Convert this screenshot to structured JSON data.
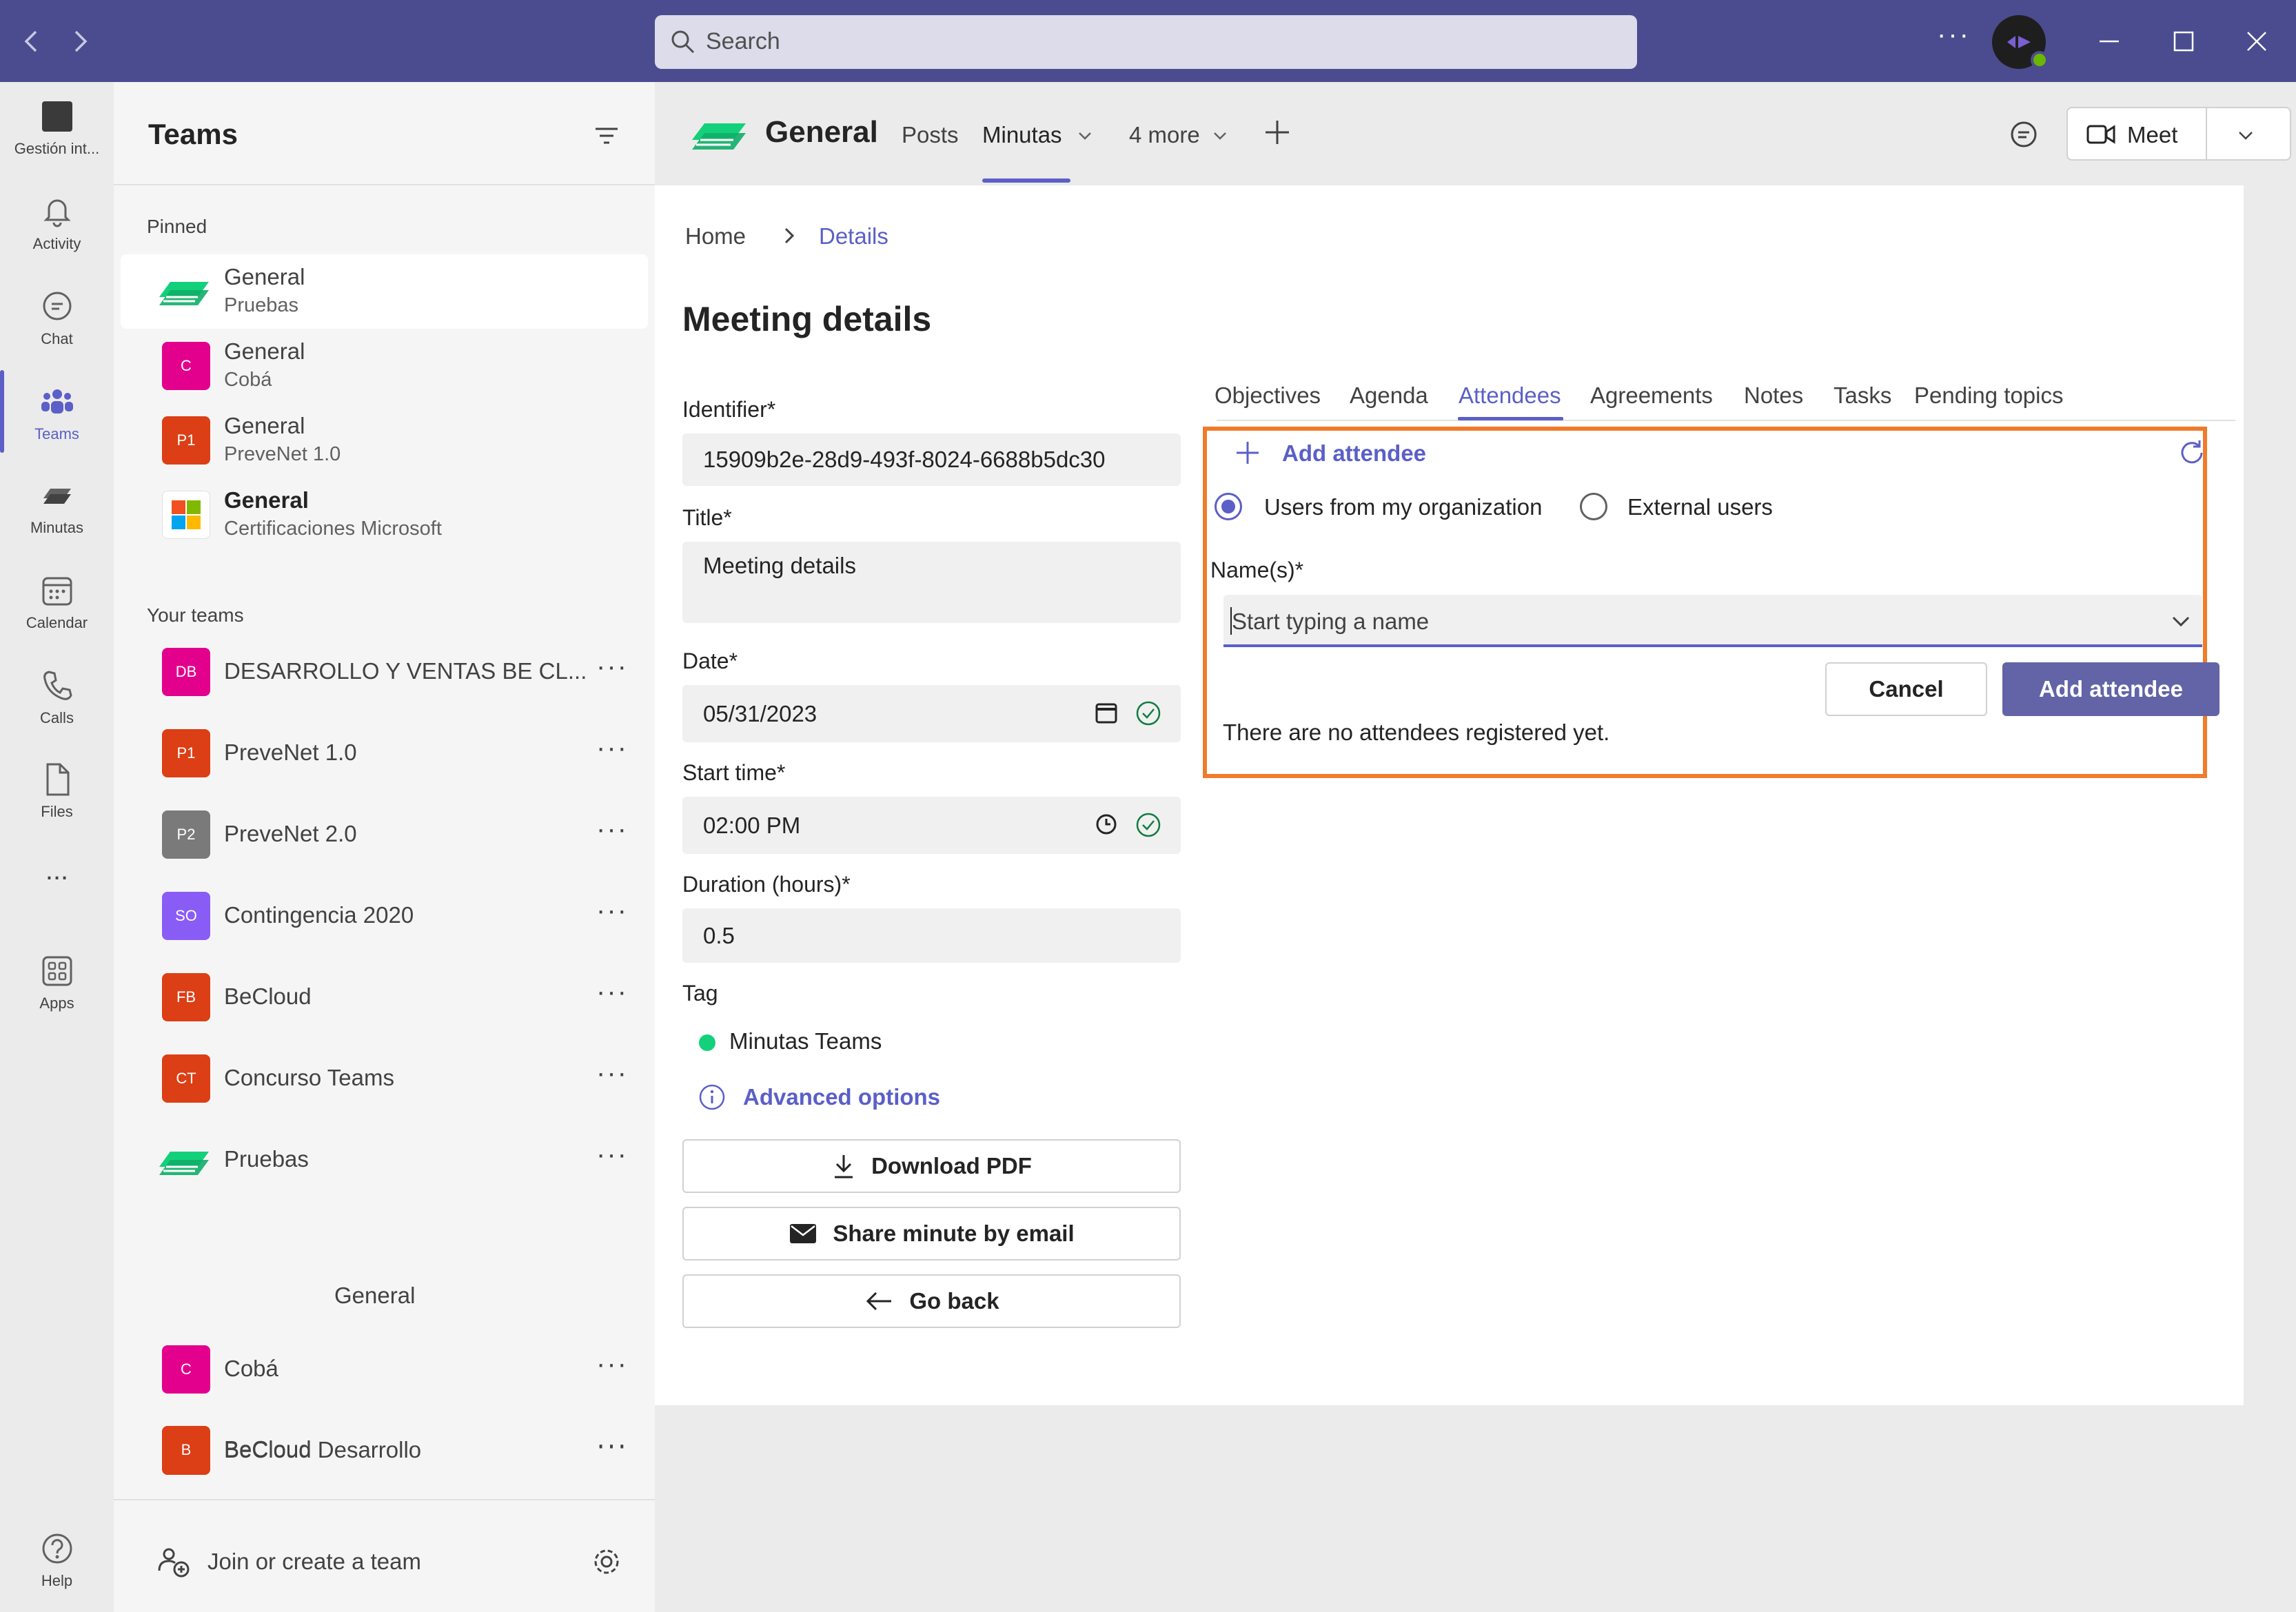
{
  "colors": {
    "brand": "#4b4c8f",
    "accent": "#5b5fc7",
    "highlight": "#f07b2a",
    "tag_dot": "#13d07a"
  },
  "titlebar": {
    "search_placeholder": "Search",
    "icons": [
      "back-arrow-icon",
      "forward-arrow-icon",
      "search-icon",
      "more-icon",
      "minimize-icon",
      "maximize-icon",
      "close-icon"
    ]
  },
  "rail": {
    "items": [
      {
        "label": "Gestión int...",
        "icon": "app-tile-icon"
      },
      {
        "label": "Activity",
        "icon": "bell-icon"
      },
      {
        "label": "Chat",
        "icon": "chat-icon"
      },
      {
        "label": "Teams",
        "icon": "teams-icon"
      },
      {
        "label": "Minutas",
        "icon": "minutas-icon"
      },
      {
        "label": "Calendar",
        "icon": "calendar-icon"
      },
      {
        "label": "Calls",
        "icon": "phone-icon"
      },
      {
        "label": "Files",
        "icon": "file-icon"
      },
      {
        "label": "...",
        "icon": "more-icon"
      },
      {
        "label": "Apps",
        "icon": "apps-icon"
      },
      {
        "label": "Help",
        "icon": "help-icon"
      }
    ]
  },
  "teams_panel": {
    "title": "Teams",
    "pinned_label": "Pinned",
    "your_teams_label": "Your teams",
    "join_label": "Join or create a team",
    "pinned": [
      {
        "name": "General",
        "sub": "Pruebas",
        "color": "#13d07a",
        "initials": ""
      },
      {
        "name": "General",
        "sub": "Cobá",
        "color": "#e3008c",
        "initials": "C"
      },
      {
        "name": "General",
        "sub": "PreveNet 1.0",
        "color": "#dc3e15",
        "initials": "P1"
      },
      {
        "name": "General",
        "sub": "Certificaciones Microsoft",
        "color": "#ffffff",
        "initials": ""
      }
    ],
    "teams": [
      {
        "name": "DESARROLLO Y VENTAS BE CL...",
        "initials": "DB",
        "color": "#e3008c"
      },
      {
        "name": "PreveNet 1.0",
        "initials": "P1",
        "color": "#dc3e15"
      },
      {
        "name": "PreveNet 2.0",
        "initials": "P2",
        "color": "#7a7a7a"
      },
      {
        "name": "Contingencia 2020",
        "initials": "SO",
        "color": "#8a5cf6"
      },
      {
        "name": "BeCloud",
        "initials": "FB",
        "color": "#dc3e15"
      },
      {
        "name": "Concurso Teams",
        "initials": "CT",
        "color": "#dc3e15"
      },
      {
        "name": "Pruebas",
        "initials": "",
        "color": "#13d07a",
        "child": "General"
      },
      {
        "name": "Cobá",
        "initials": "C",
        "color": "#e3008c"
      },
      {
        "name": "BeCloud Desarrollo",
        "initials": "BD",
        "color": "#dc3e15"
      },
      {
        "name": "BeCloud",
        "initials": "B",
        "color": "#dc3e15"
      }
    ]
  },
  "header": {
    "channel": "General",
    "tabs": [
      "Posts",
      "Minutas",
      "4 more"
    ],
    "meet_label": "Meet"
  },
  "content": {
    "breadcrumb": {
      "home": "Home",
      "current": "Details"
    },
    "title": "Meeting details",
    "identifier_label": "Identifier*",
    "identifier_value": "15909b2e-28d9-493f-8024-6688b5dc30",
    "title_label": "Title*",
    "title_value": "Meeting details",
    "date_label": "Date*",
    "date_value": "05/31/2023",
    "start_label": "Start time*",
    "start_value": "02:00 PM",
    "duration_label": "Duration (hours)*",
    "duration_value": "0.5",
    "tag_label": "Tag",
    "tag_value": "Minutas Teams",
    "advanced_label": "Advanced options",
    "download_label": "Download PDF",
    "share_label": "Share minute by email",
    "back_label": "Go back"
  },
  "detail_tabs": [
    "Objectives",
    "Agenda",
    "Attendees",
    "Agreements",
    "Notes",
    "Tasks",
    "Pending topics"
  ],
  "attendees": {
    "add_link": "Add attendee",
    "radio_org": "Users from my organization",
    "radio_ext": "External users",
    "names_label": "Name(s)*",
    "names_placeholder": "Start typing a name",
    "cancel_label": "Cancel",
    "add_label": "Add attendee",
    "empty_text": "There are no attendees registered yet."
  }
}
